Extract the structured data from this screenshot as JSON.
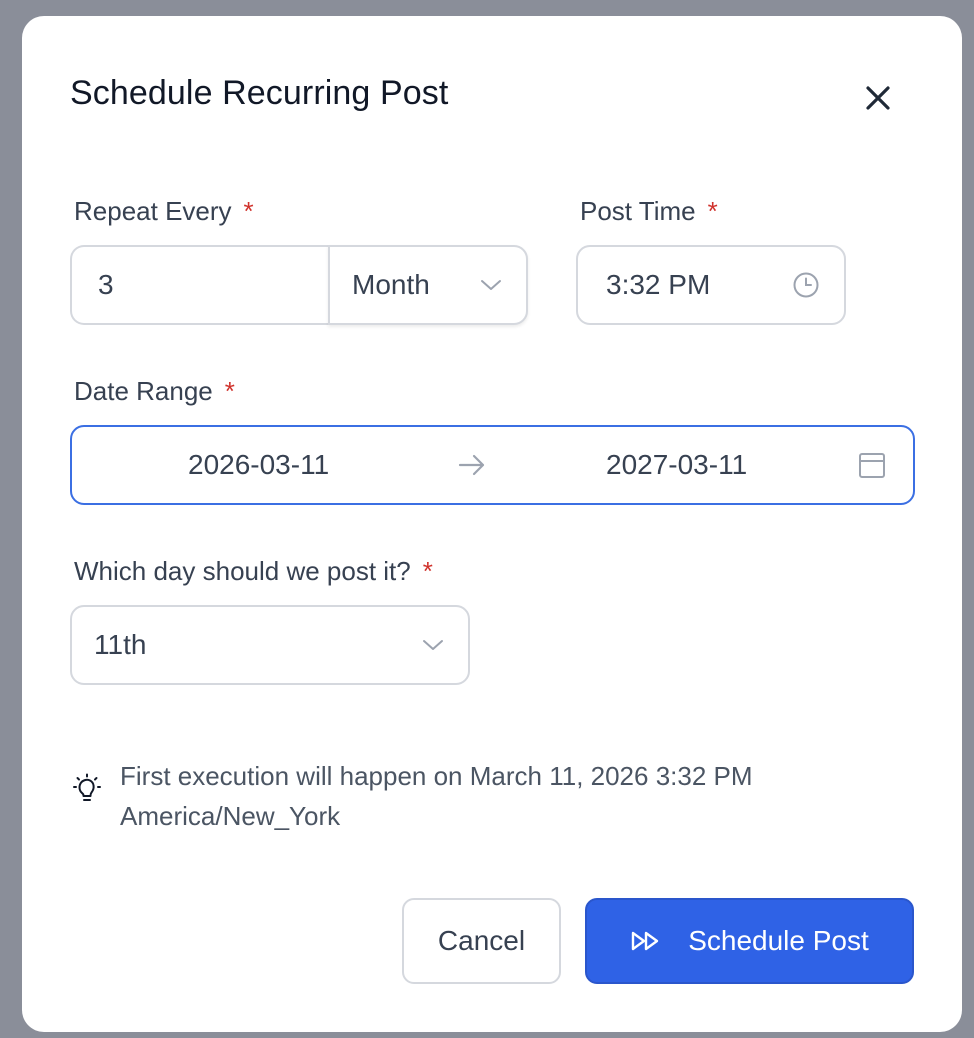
{
  "dialog": {
    "title": "Schedule Recurring Post"
  },
  "repeat_every": {
    "label": "Repeat Every",
    "required_mark": "*",
    "count_value": "3",
    "unit_value": "Month"
  },
  "post_time": {
    "label": "Post Time",
    "required_mark": "*",
    "value": "3:32 PM"
  },
  "date_range": {
    "label": "Date Range",
    "required_mark": "*",
    "start": "2026-03-11",
    "end": "2027-03-11"
  },
  "post_day": {
    "label": "Which day should we post it?",
    "required_mark": "*",
    "value": "11th"
  },
  "info": {
    "icon": "lightbulb-icon",
    "text": "First execution will happen on March 11, 2026 3:32 PM America/New_York"
  },
  "actions": {
    "cancel_label": "Cancel",
    "submit_label": "Schedule Post",
    "submit_icon": "fast-forward-icon"
  },
  "colors": {
    "primary": "#2f62e6",
    "required": "#d0322c",
    "focus_border": "#3b6fe3"
  }
}
